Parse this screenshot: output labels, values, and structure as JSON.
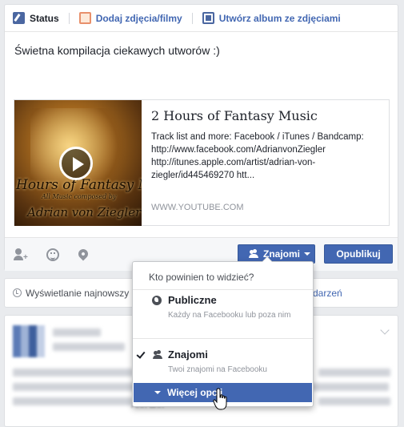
{
  "composer": {
    "tabs": [
      {
        "label": "Status"
      },
      {
        "label": "Dodaj zdjęcia/filmy"
      },
      {
        "label": "Utwórz album ze zdjęciami"
      }
    ],
    "status_text": "Świetna kompilacja ciekawych utworów :)",
    "link_preview": {
      "thumbnail": {
        "title_art": "Hours of Fantasy Music",
        "subtitle_art": "All Music composed by",
        "author_art": "Adrian von Ziegler"
      },
      "title": "2 Hours of Fantasy Music",
      "description": "Track list and more: Facebook / iTunes / Bandcamp: http://www.facebook.com/AdrianvonZiegler http://itunes.apple.com/artist/adrian-von-ziegler/id445469270 htt...",
      "domain": "WWW.YOUTUBE.COM"
    },
    "footer": {
      "icons": [
        "tag-friends-icon",
        "feeling-icon",
        "location-icon"
      ],
      "audience_label": "Znajomi",
      "publish_label": "Opublikuj"
    }
  },
  "sort_bar": {
    "left_text": "Wyświetlanie najnowszy",
    "right_text": "ch zdarzeń"
  },
  "audience_dropdown": {
    "header": "Kto powinien to widzieć?",
    "options": [
      {
        "title": "Publiczne",
        "description": "Każdy na Facebooku lub poza nim",
        "icon": "globe-icon",
        "selected": false
      },
      {
        "title": "Znajomi",
        "description": "Twoi znajomi na Facebooku",
        "icon": "friends-icon",
        "selected": true
      }
    ],
    "more_label": "Więcej opcji"
  },
  "feed_post": {
    "text_fragment": "Ann ann"
  },
  "colors": {
    "accent": "#4267b2",
    "page_bg": "#e9ebee",
    "border": "#dddfe2",
    "muted_text": "#90949c"
  }
}
